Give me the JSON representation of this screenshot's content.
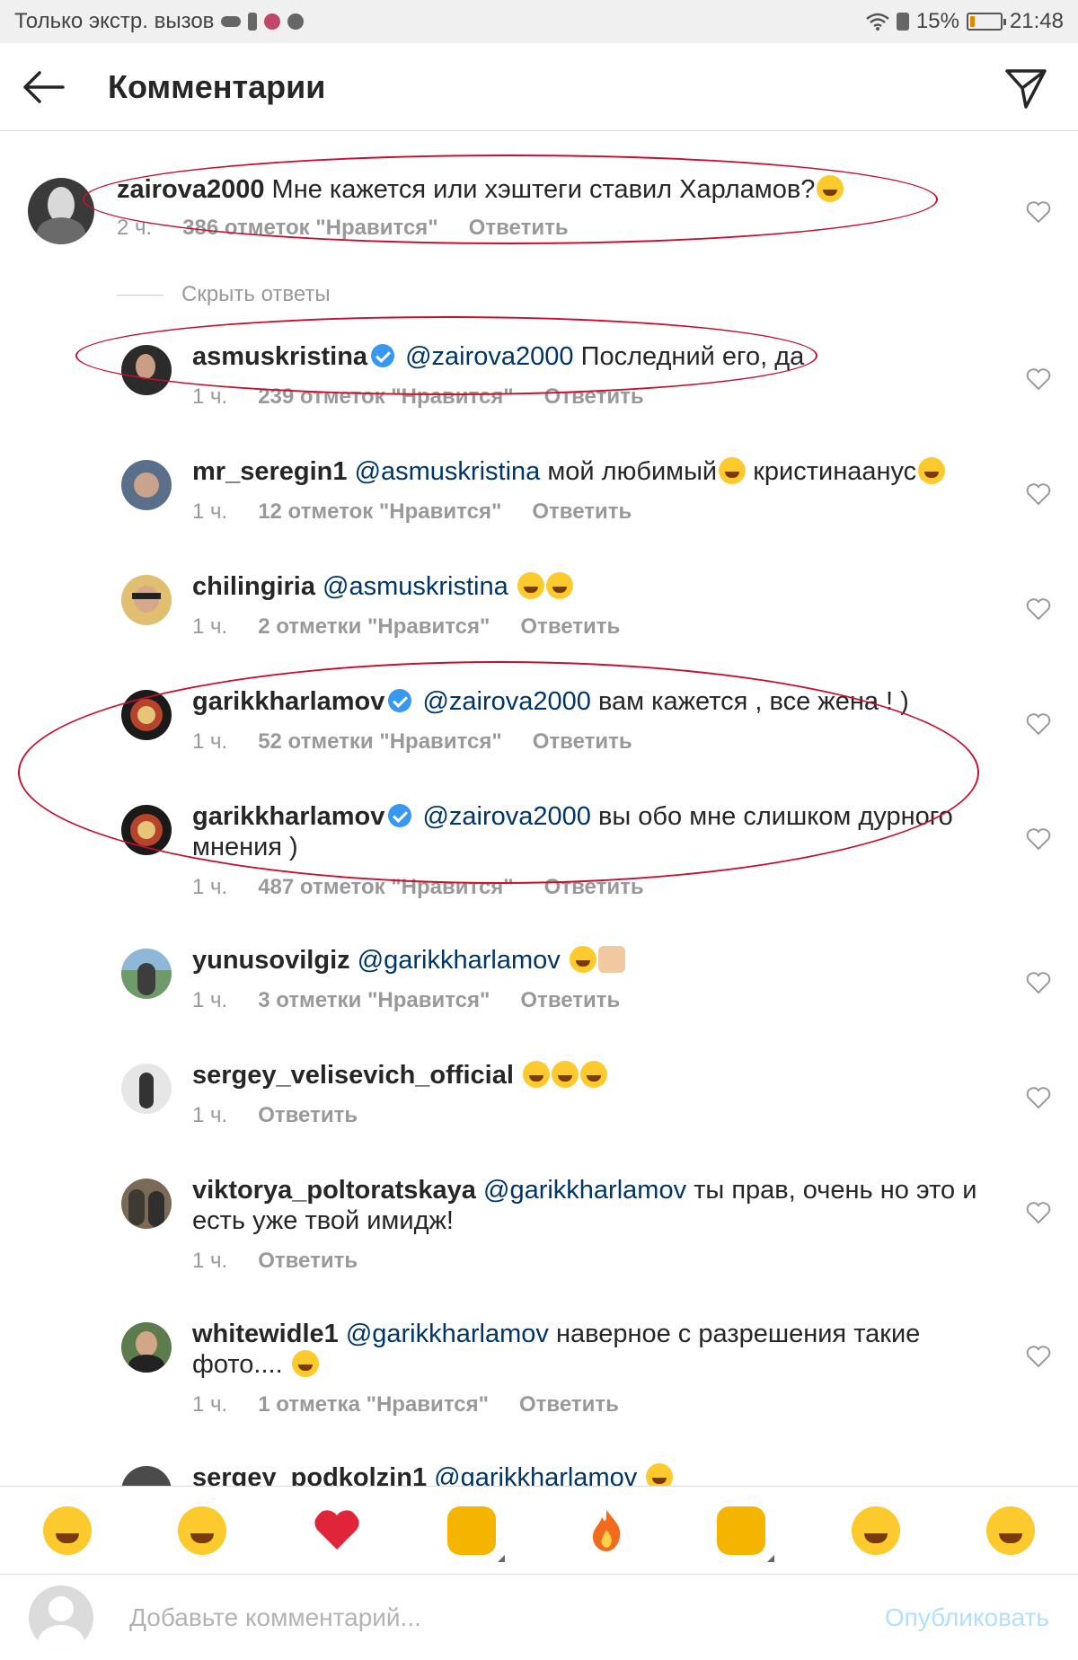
{
  "status_bar": {
    "carrier_text": "Только экстр. вызов",
    "battery_percent_text": "15%",
    "battery_level": 0.15,
    "time": "21:48"
  },
  "header": {
    "title": "Комментарии",
    "back_icon": "arrow-left-icon",
    "share_icon": "paper-plane-icon"
  },
  "top_comment": {
    "username": "zairova2000",
    "text": "Мне кажется или хэштеги ставил Харламов?",
    "time": "2 ч.",
    "likes": "386 отметок \"Нравится\"",
    "reply": "Ответить",
    "hide_replies": "Скрыть ответы"
  },
  "replies": [
    {
      "username": "asmuskristina",
      "verified": true,
      "mention": "@zairova2000",
      "text": "Последний его, да",
      "time": "1 ч.",
      "likes": "239 отметок \"Нравится\"",
      "reply": "Ответить"
    }
  ],
  "comments": [
    {
      "username": "mr_seregin1",
      "mention": "@asmuskristina",
      "text": "мой любимый",
      "text2": "кристинаанус",
      "time": "1 ч.",
      "likes": "12 отметок \"Нравится\"",
      "reply": "Ответить"
    },
    {
      "username": "chilingiria",
      "mention": "@asmuskristina",
      "text": "",
      "time": "1 ч.",
      "likes": "2 отметки \"Нравится\"",
      "reply": "Ответить"
    },
    {
      "username": "garikkharlamov",
      "verified": true,
      "mention": "@zairova2000",
      "text": "вам кажется , все жена ! )",
      "time": "1 ч.",
      "likes": "52 отметки \"Нравится\"",
      "reply": "Ответить"
    },
    {
      "username": "garikkharlamov",
      "verified": true,
      "mention": "@zairova2000",
      "text": "вы обо мне слишком дурного мнения )",
      "time": "1 ч.",
      "likes": "487 отметок \"Нравится\"",
      "reply": "Ответить"
    },
    {
      "username": "yunusovilgiz",
      "mention": "@garikkharlamov",
      "text": "",
      "time": "1 ч.",
      "likes": "3 отметки \"Нравится\"",
      "reply": "Ответить"
    },
    {
      "username": "sergey_velisevich_official",
      "text": "",
      "time": "1 ч.",
      "reply": "Ответить"
    },
    {
      "username": "viktorya_poltoratskaya",
      "mention": "@garikkharlamov",
      "text": "ты прав, очень но это и есть уже твой имидж!",
      "time": "1 ч.",
      "reply": "Ответить"
    },
    {
      "username": "whitewidle1",
      "mention": "@garikkharlamov",
      "text": "наверное с разрешения такие фото....",
      "time": "1 ч.",
      "likes": "1 отметка \"Нравится\"",
      "reply": "Ответить"
    },
    {
      "username": "sergey_podkolzin1",
      "mention": "@garikkharlamov",
      "text": ""
    }
  ],
  "quick_emojis": [
    "tears-of-joy",
    "grinning-sweat",
    "red-heart",
    "raising-hands",
    "fire",
    "clapping-hands",
    "crying-face",
    "heart-eyes"
  ],
  "composer": {
    "placeholder": "Добавьте комментарий...",
    "publish_label": "Опубликовать"
  },
  "colors": {
    "mention": "#003569",
    "meta": "#999999",
    "annotation": "#c8102e",
    "verified": "#3897f0",
    "publish_disabled": "#b2dffc"
  }
}
